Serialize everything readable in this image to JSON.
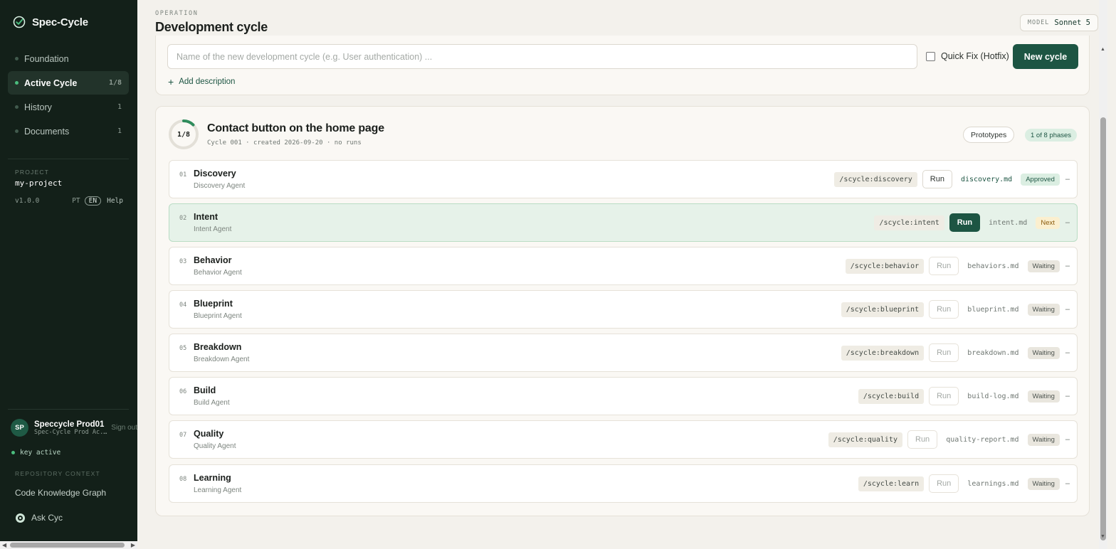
{
  "brand": {
    "name": "Spec-Cycle"
  },
  "nav": [
    {
      "label": "Foundation",
      "count": "",
      "active": false
    },
    {
      "label": "Active Cycle",
      "count": "1/8",
      "active": true
    },
    {
      "label": "History",
      "count": "1",
      "active": false
    },
    {
      "label": "Documents",
      "count": "1",
      "active": false
    }
  ],
  "project": {
    "label": "PROJECT",
    "name": "my-project",
    "version": "v1.0.0",
    "lang_pt": "PT",
    "lang_en": "EN",
    "help": "Help"
  },
  "user": {
    "initials": "SP",
    "name": "Speccycle Prod01",
    "sub": "Spec-Cycle Prod Ac...",
    "signout": "Sign out",
    "key_status": "key active"
  },
  "repo": {
    "label": "REPOSITORY CONTEXT",
    "graph": "Code Knowledge Graph",
    "ask": "Ask Cyc"
  },
  "header": {
    "eyebrow": "OPERATION",
    "title": "Development cycle",
    "model_label": "MODEL",
    "model_value": "Sonnet 5"
  },
  "new_cycle": {
    "placeholder": "Name of the new development cycle (e.g. User authentication) ...",
    "value": "",
    "quick_fix": "Quick Fix (Hotfix)",
    "button": "New cycle",
    "add_description": "Add description"
  },
  "cycle": {
    "progress_label": "1/8",
    "progress": 0.125,
    "title": "Contact button on the home page",
    "meta": "Cycle 001 · created 2026-09-20 · no runs",
    "prototypes": "Prototypes",
    "phases_pill": "1 of 8 phases"
  },
  "phases": [
    {
      "num": "01",
      "name": "Discovery",
      "agent": "Discovery Agent",
      "cmd": "/scycle:discovery",
      "run": "Run",
      "file": "discovery.md",
      "status": "Approved",
      "state": "approved",
      "dash": "–"
    },
    {
      "num": "02",
      "name": "Intent",
      "agent": "Intent Agent",
      "cmd": "/scycle:intent",
      "run": "Run",
      "file": "intent.md",
      "status": "Next",
      "state": "next",
      "dash": "–"
    },
    {
      "num": "03",
      "name": "Behavior",
      "agent": "Behavior Agent",
      "cmd": "/scycle:behavior",
      "run": "Run",
      "file": "behaviors.md",
      "status": "Waiting",
      "state": "waiting",
      "dash": "–"
    },
    {
      "num": "04",
      "name": "Blueprint",
      "agent": "Blueprint Agent",
      "cmd": "/scycle:blueprint",
      "run": "Run",
      "file": "blueprint.md",
      "status": "Waiting",
      "state": "waiting",
      "dash": "–"
    },
    {
      "num": "05",
      "name": "Breakdown",
      "agent": "Breakdown Agent",
      "cmd": "/scycle:breakdown",
      "run": "Run",
      "file": "breakdown.md",
      "status": "Waiting",
      "state": "waiting",
      "dash": "–"
    },
    {
      "num": "06",
      "name": "Build",
      "agent": "Build Agent",
      "cmd": "/scycle:build",
      "run": "Run",
      "file": "build-log.md",
      "status": "Waiting",
      "state": "waiting",
      "dash": "–"
    },
    {
      "num": "07",
      "name": "Quality",
      "agent": "Quality Agent",
      "cmd": "/scycle:quality",
      "run": "Run",
      "file": "quality-report.md",
      "status": "Waiting",
      "state": "waiting",
      "dash": "–"
    },
    {
      "num": "08",
      "name": "Learning",
      "agent": "Learning Agent",
      "cmd": "/scycle:learn",
      "run": "Run",
      "file": "learnings.md",
      "status": "Waiting",
      "state": "waiting",
      "dash": "–"
    }
  ],
  "colors": {
    "sidebar_bg": "#132019",
    "accent": "#1d5543",
    "active_dot": "#4bbd7e",
    "page_bg": "#f3f1ec"
  }
}
